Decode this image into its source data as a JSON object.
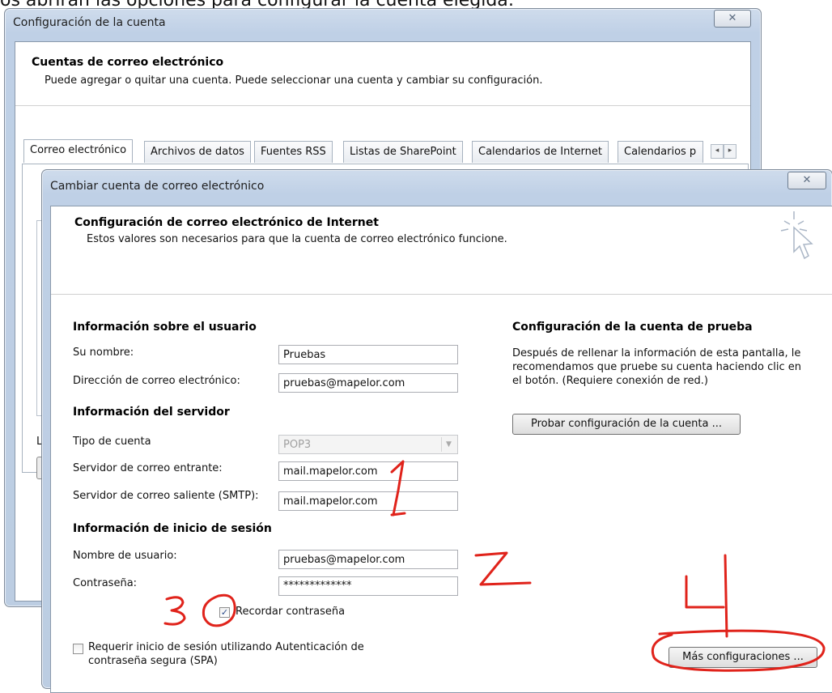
{
  "caption": "os abrirán las opciones para configurar la cuenta elegida:",
  "account_settings": {
    "title": "Configuración de la cuenta",
    "close_symbol": "✕",
    "heading": "Cuentas de correo electrónico",
    "description": "Puede agregar o quitar una cuenta. Puede seleccionar una cuenta y cambiar su configuración.",
    "tabs": [
      "Correo electrónico",
      "Archivos de datos",
      "Fuentes RSS",
      "Listas de SharePoint",
      "Calendarios de Internet",
      "Calendarios p"
    ],
    "left_partial": "L"
  },
  "change_account": {
    "title": "Cambiar cuenta de correo electrónico",
    "close_symbol": "✕",
    "heading": "Configuración de correo electrónico de Internet",
    "description": "Estos valores son necesarios para que la cuenta de correo electrónico funcione.",
    "user_info": {
      "heading": "Información sobre el usuario",
      "name_label": "Su nombre:",
      "name_value": "Pruebas",
      "email_label": "Dirección de correo electrónico:",
      "email_value": "pruebas@mapelor.com"
    },
    "server_info": {
      "heading": "Información del servidor",
      "account_type_label": "Tipo de cuenta",
      "account_type_value": "POP3",
      "incoming_label": "Servidor de correo entrante:",
      "incoming_value": "mail.mapelor.com",
      "outgoing_label": "Servidor de correo saliente (SMTP):",
      "outgoing_value": "mail.mapelor.com"
    },
    "logon_info": {
      "heading": "Información de inicio de sesión",
      "username_label": "Nombre de usuario:",
      "username_value": "pruebas@mapelor.com",
      "password_label": "Contraseña:",
      "password_value": "*************",
      "remember_label": "Recordar contraseña",
      "spa_label_line1": "Requerir inicio de sesión utilizando Autenticación de",
      "spa_label_line2": "contraseña segura (SPA)"
    },
    "test": {
      "heading": "Configuración de la cuenta de prueba",
      "text_line1": "Después de rellenar la información de esta pantalla, le",
      "text_line2": "recomendamos que pruebe su cuenta haciendo clic en",
      "text_line3": "el botón. (Requiere conexión de red.)",
      "test_button": "Probar configuración de la cuenta ...",
      "more_button": "Más configuraciones ..."
    }
  },
  "annotations": {
    "num1": "1",
    "num2": "2",
    "num3": "3",
    "num4": "4",
    "color": "#e0231b"
  }
}
